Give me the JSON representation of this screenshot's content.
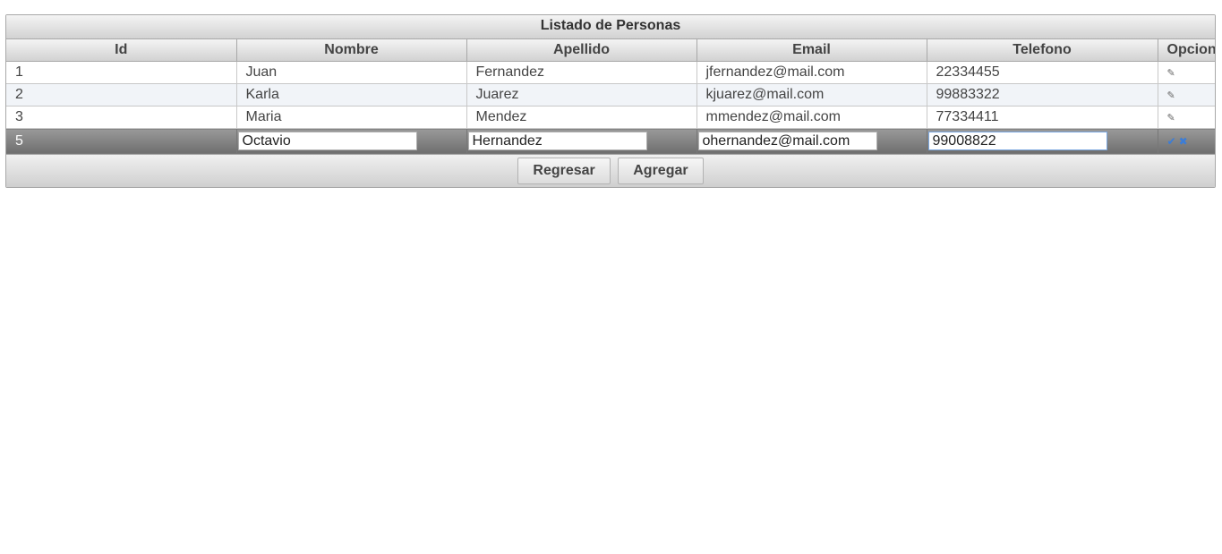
{
  "grid": {
    "caption": "Listado de Personas",
    "columns": [
      "Id",
      "Nombre",
      "Apellido",
      "Email",
      "Telefono",
      "Opcion"
    ],
    "rows": [
      {
        "id": "1",
        "nombre": "Juan",
        "apellido": "Fernandez",
        "email": "jfernandez@mail.com",
        "telefono": "22334455"
      },
      {
        "id": "2",
        "nombre": "Karla",
        "apellido": "Juarez",
        "email": "kjuarez@mail.com",
        "telefono": "99883322"
      },
      {
        "id": "3",
        "nombre": "Maria",
        "apellido": "Mendez",
        "email": "mmendez@mail.com",
        "telefono": "77334411"
      }
    ],
    "editing_row": {
      "id": "5",
      "nombre": "Octavio",
      "apellido": "Hernandez",
      "email": "ohernandez@mail.com",
      "telefono": "99008822"
    },
    "icons": {
      "edit": "pencil-icon",
      "save": "check-icon",
      "cancel": "close-icon"
    }
  },
  "buttons": {
    "back": "Regresar",
    "add": "Agregar"
  }
}
